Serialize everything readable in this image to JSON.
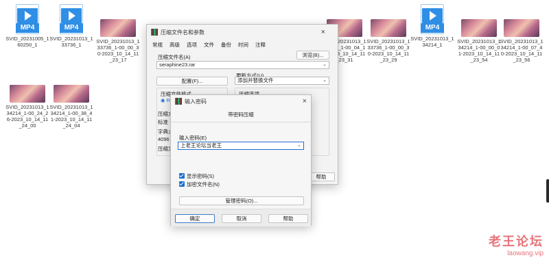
{
  "desktop": {
    "files": [
      {
        "kind": "mp4",
        "badge": "MP4",
        "name": "SVID_20231005_160250_1"
      },
      {
        "kind": "mp4",
        "badge": "MP4",
        "name": "SVID_20231013_133736_1"
      },
      {
        "kind": "thumb",
        "name": "SVID_20231013_133736_1-00_00_30-2023_10_14_11_23_17"
      },
      {
        "kind": "thumb",
        "name": "SVID_20231013_133736_1-00_04_10-2023_10_14_11_23_31"
      },
      {
        "kind": "thumb",
        "name": "SVID_20231013_133736_1-00_00_30-2023_10_14_11_23_29"
      },
      {
        "kind": "mp4",
        "badge": "MP4",
        "name": "SVID_20231013_134214_1"
      },
      {
        "kind": "thumb",
        "name": "SVID_20231013_134214_1-00_00_01-2023_10_14_11_23_54"
      },
      {
        "kind": "thumb",
        "name": "SVID_20231013_134214_1-00_07_40-2023_10_14_11_23_56"
      },
      {
        "kind": "thumb",
        "name": "SVID_20231013_134214_1-00_24_26-2023_10_14_11_24_00"
      },
      {
        "kind": "thumb",
        "name": "SVID_20231013_134214_1-00_38_41-2023_10_14_11_24_04"
      }
    ]
  },
  "archive_dialog": {
    "title": "压缩文件名和参数",
    "close": "×",
    "tabs": [
      "常规",
      "高级",
      "选项",
      "文件",
      "备份",
      "时间",
      "注释"
    ],
    "archive_name_label": "压缩文件名(A)",
    "archive_name_value": "seraphine23.rar",
    "browse_button": "浏览(B)...",
    "update_mode_label": "更新方式(U)",
    "update_mode_value": "添加并替换文件",
    "profiles_button": "配置(F)...",
    "format_label": "压缩文件格式",
    "format_radio": "R",
    "method_label": "压缩方",
    "method_value": "标准",
    "dict_label": "字典大",
    "dict_value": "4096",
    "split_label": "压缩为",
    "options_label": "压缩选项",
    "help_button": "帮助"
  },
  "password_dialog": {
    "title": "输入密码",
    "close": "×",
    "heading": "带密码压缩",
    "password_label": "输入密码(E)",
    "password_value": "上老王论坛当老王",
    "show_password": "显示密码(S)",
    "encrypt_names": "加密文件名(N)",
    "manage_button": "管理密码(O)...",
    "ok_button": "确定",
    "cancel_button": "取消",
    "help_button": "帮助"
  },
  "watermark": {
    "line1": "老王论坛",
    "line2": "laowang.vip"
  }
}
